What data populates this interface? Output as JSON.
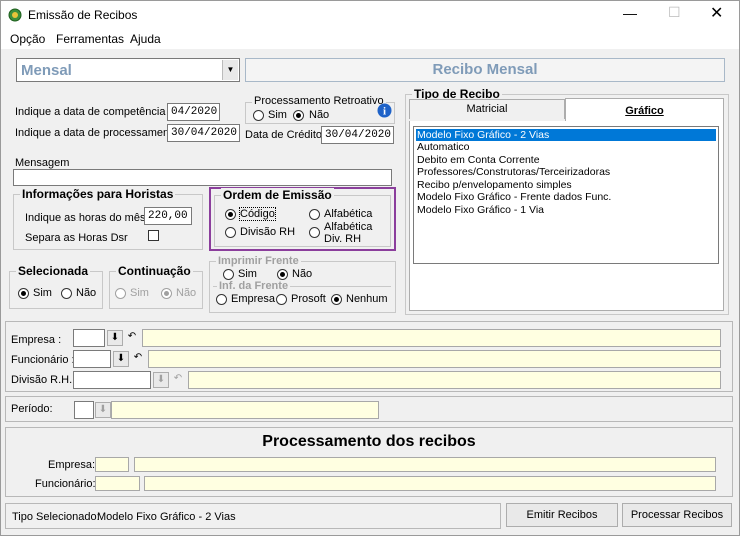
{
  "window": {
    "title": "Emissão de Recibos"
  },
  "menu": [
    "Opção",
    "Ferramentas",
    "Ajuda"
  ],
  "top": {
    "period_select": "Mensal",
    "banner": "Recibo Mensal"
  },
  "dates": {
    "competencia_label": "Indique a data de competência",
    "competencia_value": "04/2020",
    "processamento_label": "Indique a data de processamento",
    "processamento_value": "30/04/2020",
    "credito_label": "Data de Crédito",
    "credito_value": "30/04/2020"
  },
  "retroativo": {
    "title": "Processamento Retroativo",
    "sim": "Sim",
    "nao": "Não"
  },
  "mensagem": {
    "label": "Mensagem",
    "value": ""
  },
  "horistas": {
    "title": "Informações para Horistas",
    "horas_label": "Indique as horas do mês",
    "horas_value": "220,00",
    "separa_label": "Separa as Horas Dsr"
  },
  "ordem": {
    "title": "Ordem de Emissão",
    "codigo": "Código",
    "alfabetica": "Alfabética",
    "divisao": "Divisão RH",
    "alfabetica_div_1": "Alfabética",
    "alfabetica_div_2": "Div. RH"
  },
  "selecionada": {
    "title": "Selecionada",
    "sim": "Sim",
    "nao": "Não"
  },
  "continuacao": {
    "title": "Continuação",
    "sim": "Sim",
    "nao": "Não"
  },
  "frente": {
    "title": "Imprimir Frente",
    "sim": "Sim",
    "nao": "Não",
    "inf_title": "Inf. da Frente",
    "empresa": "Empresa",
    "prosoft": "Prosoft",
    "nenhum": "Nenhum"
  },
  "tipo": {
    "title": "Tipo de Recibo",
    "tab_matricial": "Matricial",
    "tab_grafico": "Gráfico",
    "items": [
      "Modelo Fixo Gráfico - 2 Vias",
      "Automatico",
      "Debito em Conta Corrente",
      "Professores/Construtoras/Terceirizadoras",
      "Recibo p/envelopamento simples",
      "Modelo Fixo Gráfico - Frente dados Func.",
      "Modelo Fixo Gráfico - 1 Via"
    ]
  },
  "filtros": {
    "empresa": "Empresa :",
    "funcionario": "Funcionário :",
    "divisao": "Divisão R.H. :",
    "periodo": "Período:"
  },
  "processamento": {
    "title": "Processamento dos recibos",
    "empresa": "Empresa:",
    "funcionario": "Funcionário:"
  },
  "status": {
    "tipo_label": "Tipo Selecionado:",
    "tipo_value": "Modelo Fixo Gráfico - 2 Vias",
    "emitir": "Emitir Recibos",
    "processar": "Processar Recibos"
  },
  "colors": {
    "accent": "#0078d7",
    "highlight_border": "#8b3e9c",
    "banner_text": "#7f9bb8"
  }
}
